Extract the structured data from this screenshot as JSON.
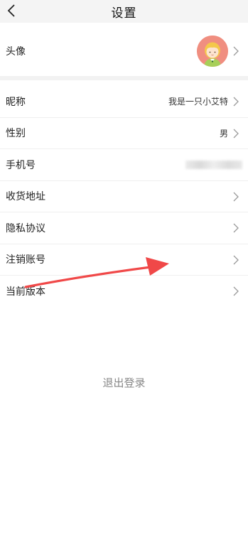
{
  "header": {
    "title": "设置"
  },
  "avatar_row": {
    "label": "头像"
  },
  "rows": [
    {
      "label": "昵称",
      "value": "我是一只小艾特"
    },
    {
      "label": "性别",
      "value": "男"
    },
    {
      "label": "手机号",
      "value": ""
    },
    {
      "label": "收货地址",
      "value": ""
    },
    {
      "label": "隐私协议",
      "value": ""
    },
    {
      "label": "注销账号",
      "value": ""
    },
    {
      "label": "当前版本",
      "value": ""
    }
  ],
  "logout": {
    "label": "退出登录"
  },
  "colors": {
    "annotation_arrow": "#f04848",
    "avatar_bg": "#f08e80"
  }
}
